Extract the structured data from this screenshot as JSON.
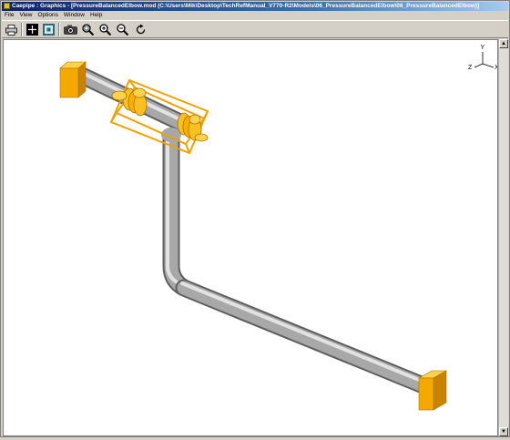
{
  "window": {
    "title": "Caepipe : Graphics - [PressureBalancedElbow.mod (C:\\Users\\Mik\\Desktop\\TechRefManual_V770-R2\\Models\\06_PressureBalancedElbow\\06_PressureBalancedElbow)]"
  },
  "menu": {
    "items": [
      "File",
      "View",
      "Options",
      "Window",
      "Help"
    ]
  },
  "toolbar": {
    "buttons": [
      {
        "name": "print",
        "icon": "printer-icon"
      },
      {
        "name": "mode",
        "icon": "crosshair-icon"
      },
      {
        "name": "view",
        "icon": "view-frame-icon"
      },
      {
        "name": "snapshot",
        "icon": "camera-icon"
      },
      {
        "name": "zoom-window",
        "icon": "zoom-window-icon"
      },
      {
        "name": "zoom-in",
        "icon": "zoom-in-icon"
      },
      {
        "name": "zoom-out",
        "icon": "zoom-out-icon"
      },
      {
        "name": "rotate",
        "icon": "rotate-icon"
      }
    ]
  },
  "triad": {
    "y_label": "Y",
    "z_label": "Z",
    "x_label": "X"
  },
  "colors": {
    "pipe": "#a0a0a0",
    "anchor": "#f5a800",
    "hanger": "#f0b000",
    "title_gradient_start": "#0a246a"
  }
}
